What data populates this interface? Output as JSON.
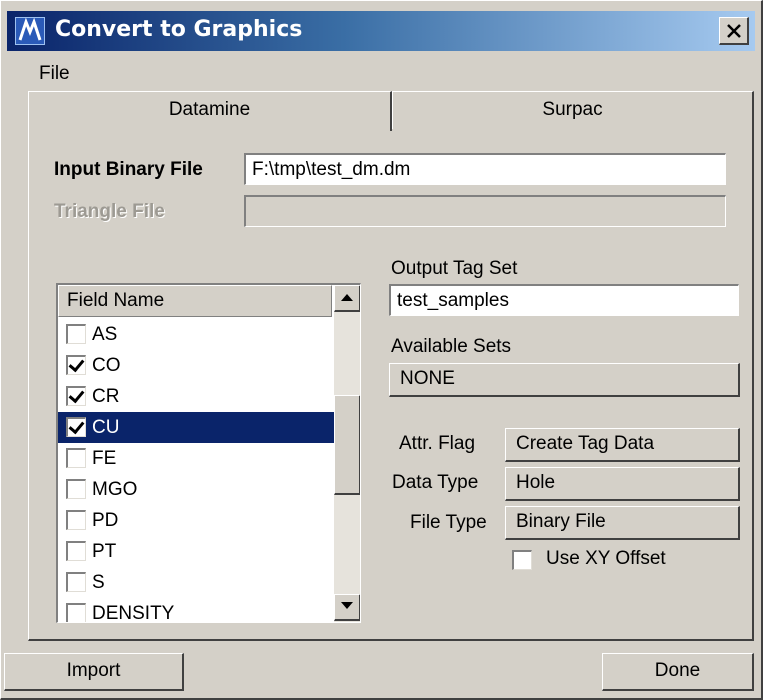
{
  "window": {
    "title": "Convert to Graphics",
    "close_glyph": "✕"
  },
  "menu": {
    "file": "File"
  },
  "tabs": [
    {
      "label": "Datamine",
      "active": true
    },
    {
      "label": "Surpac",
      "active": false
    }
  ],
  "input_file": {
    "label": "Input Binary File",
    "value": "F:\\tmp\\test_dm.dm"
  },
  "triangle_file": {
    "label": "Triangle File",
    "value": ""
  },
  "field_list": {
    "header": "Field Name",
    "items": [
      {
        "label": "AS",
        "checked": false,
        "selected": false
      },
      {
        "label": "CO",
        "checked": true,
        "selected": false
      },
      {
        "label": "CR",
        "checked": true,
        "selected": false
      },
      {
        "label": "CU",
        "checked": true,
        "selected": true
      },
      {
        "label": "FE",
        "checked": false,
        "selected": false
      },
      {
        "label": "MGO",
        "checked": false,
        "selected": false
      },
      {
        "label": "PD",
        "checked": false,
        "selected": false
      },
      {
        "label": "PT",
        "checked": false,
        "selected": false
      },
      {
        "label": "S",
        "checked": false,
        "selected": false
      },
      {
        "label": "DENSITY",
        "checked": false,
        "selected": false
      }
    ]
  },
  "output_tag_set": {
    "label": "Output Tag Set",
    "value": "test_samples"
  },
  "available_sets": {
    "label": "Available Sets",
    "value": "NONE"
  },
  "attr_flag": {
    "label": "Attr. Flag",
    "value": "Create Tag Data"
  },
  "data_type": {
    "label": "Data Type",
    "value": "Hole"
  },
  "file_type": {
    "label": "File Type",
    "value": "Binary File"
  },
  "use_xy_offset": {
    "label": "Use XY Offset",
    "checked": false
  },
  "buttons": {
    "import": "Import",
    "done": "Done"
  },
  "colors": {
    "title_bar_start": "#0a246a",
    "title_bar_end": "#a6caf0",
    "selection": "#0a246a",
    "face": "#d4d0c8"
  },
  "icons": {
    "app": "app-logo-icon",
    "close": "close-icon",
    "scroll_up": "scroll-up-arrow-icon",
    "scroll_down": "scroll-down-arrow-icon",
    "check": "checkmark-icon"
  }
}
